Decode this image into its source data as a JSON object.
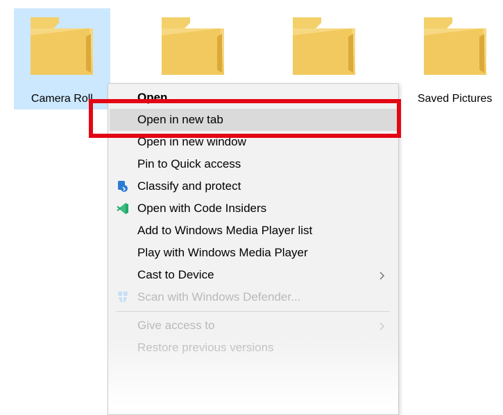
{
  "folders": [
    {
      "label": "Camera Roll",
      "selected": true
    },
    {
      "label": "",
      "selected": false
    },
    {
      "label": "",
      "selected": false
    },
    {
      "label": "Saved Pictures",
      "selected": false
    }
  ],
  "context_menu": {
    "items": [
      {
        "label": "Open",
        "bold": true
      },
      {
        "label": "Open in new tab",
        "hover": true
      },
      {
        "label": "Open in new window"
      },
      {
        "label": "Pin to Quick access"
      },
      {
        "label": "Classify and protect",
        "icon": "classify"
      },
      {
        "label": "Open with Code Insiders",
        "icon": "code"
      },
      {
        "label": "Add to Windows Media Player list"
      },
      {
        "label": "Play with Windows Media Player"
      },
      {
        "label": "Cast to Device",
        "submenu": true
      },
      {
        "label": "Scan with Windows Defender...",
        "icon": "defender",
        "faded": true
      },
      {
        "separator": true
      },
      {
        "label": "Give access to",
        "submenu": true,
        "faded": true
      },
      {
        "label": "Restore previous versions",
        "faded": true
      }
    ]
  }
}
